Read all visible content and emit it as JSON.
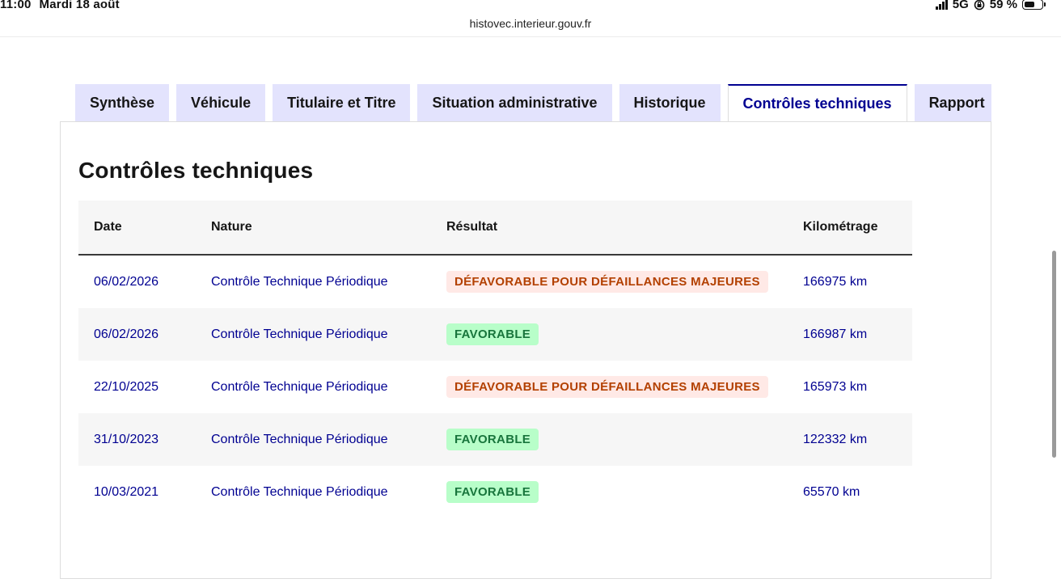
{
  "status_bar": {
    "time": "11:00",
    "date": "Mardi 18 août",
    "network": "5G",
    "battery": "59 %"
  },
  "browser": {
    "url": "histovec.interieur.gouv.fr"
  },
  "tabs": [
    {
      "label": "Synthèse",
      "active": false
    },
    {
      "label": "Véhicule",
      "active": false
    },
    {
      "label": "Titulaire et Titre",
      "active": false
    },
    {
      "label": "Situation administrative",
      "active": false
    },
    {
      "label": "Historique",
      "active": false
    },
    {
      "label": "Contrôles techniques",
      "active": true
    },
    {
      "label": "Rapport",
      "active": false
    }
  ],
  "page": {
    "title": "Contrôles techniques"
  },
  "table": {
    "headers": {
      "date": "Date",
      "nature": "Nature",
      "result": "Résultat",
      "mileage": "Kilométrage"
    },
    "rows": [
      {
        "date": "06/02/2026",
        "nature": "Contrôle Technique Périodique",
        "result": "DÉFAVORABLE POUR DÉFAILLANCES MAJEURES",
        "status": "error",
        "mileage": "166975 km"
      },
      {
        "date": "06/02/2026",
        "nature": "Contrôle Technique Périodique",
        "result": "FAVORABLE",
        "status": "success",
        "mileage": "166987 km"
      },
      {
        "date": "22/10/2025",
        "nature": "Contrôle Technique Périodique",
        "result": "DÉFAVORABLE POUR DÉFAILLANCES MAJEURES",
        "status": "error",
        "mileage": "165973 km"
      },
      {
        "date": "31/10/2023",
        "nature": "Contrôle Technique Périodique",
        "result": "FAVORABLE",
        "status": "success",
        "mileage": "122332 km"
      },
      {
        "date": "10/03/2021",
        "nature": "Contrôle Technique Périodique",
        "result": "FAVORABLE",
        "status": "success",
        "mileage": "65570 km"
      }
    ]
  },
  "colors": {
    "primary_blue": "#000091",
    "tab_background": "#e3e3fd",
    "error_bg": "#ffe9e6",
    "error_text": "#b34000",
    "success_bg": "#b8fec9",
    "success_text": "#18753c"
  }
}
